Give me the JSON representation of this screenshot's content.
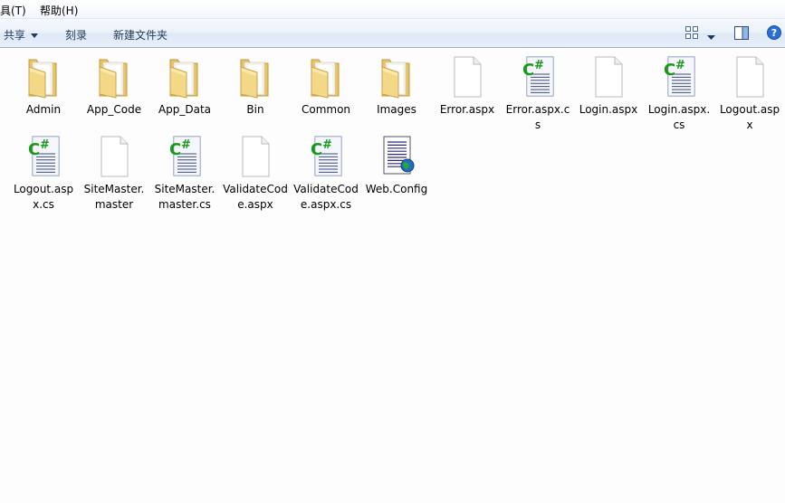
{
  "menu": {
    "tools": "具(T)",
    "help": "帮助(H)"
  },
  "toolbar": {
    "share": "共享",
    "burn": "刻录",
    "new_folder": "新建文件夹"
  },
  "items": [
    {
      "name": "Admin",
      "type": "folder"
    },
    {
      "name": "App_Code",
      "type": "folder"
    },
    {
      "name": "App_Data",
      "type": "folder"
    },
    {
      "name": "Bin",
      "type": "folder"
    },
    {
      "name": "Common",
      "type": "folder"
    },
    {
      "name": "Images",
      "type": "folder"
    },
    {
      "name": "Error.aspx",
      "type": "blank"
    },
    {
      "name": "Error.aspx.cs",
      "type": "csharp"
    },
    {
      "name": "Login.aspx",
      "type": "blank"
    },
    {
      "name": "Login.aspx.cs",
      "type": "csharp"
    },
    {
      "name": "Logout.aspx",
      "type": "blank"
    },
    {
      "name": "Logout.aspx.cs",
      "type": "csharp"
    },
    {
      "name": "SiteMaster.master",
      "type": "blank"
    },
    {
      "name": "SiteMaster.master.cs",
      "type": "csharp"
    },
    {
      "name": "ValidateCode.aspx",
      "type": "blank"
    },
    {
      "name": "ValidateCode.aspx.cs",
      "type": "csharp"
    },
    {
      "name": "Web.Config",
      "type": "config"
    }
  ]
}
